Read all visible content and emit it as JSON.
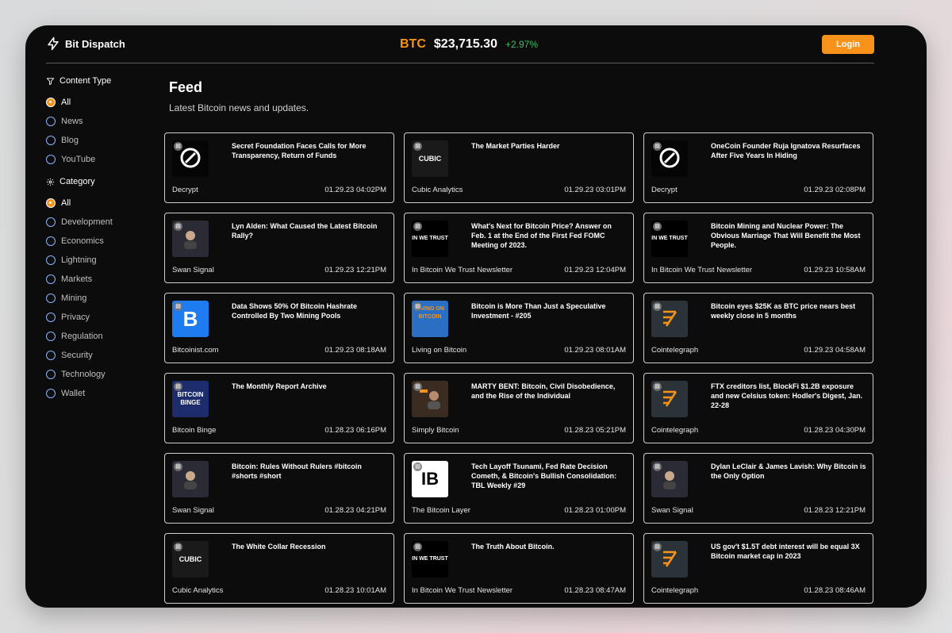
{
  "brand": {
    "name": "Bit Dispatch"
  },
  "ticker": {
    "symbol": "BTC",
    "price": "$23,715.30",
    "change": "+2.97%"
  },
  "header": {
    "login_label": "Login"
  },
  "sidebar": {
    "content_type": {
      "title": "Content Type",
      "options": [
        {
          "label": "All",
          "checked": true
        },
        {
          "label": "News",
          "checked": false
        },
        {
          "label": "Blog",
          "checked": false
        },
        {
          "label": "YouTube",
          "checked": false
        }
      ]
    },
    "category": {
      "title": "Category",
      "options": [
        {
          "label": "All",
          "checked": true
        },
        {
          "label": "Development",
          "checked": false
        },
        {
          "label": "Economics",
          "checked": false
        },
        {
          "label": "Lightning",
          "checked": false
        },
        {
          "label": "Markets",
          "checked": false
        },
        {
          "label": "Mining",
          "checked": false
        },
        {
          "label": "Privacy",
          "checked": false
        },
        {
          "label": "Regulation",
          "checked": false
        },
        {
          "label": "Security",
          "checked": false
        },
        {
          "label": "Technology",
          "checked": false
        },
        {
          "label": "Wallet",
          "checked": false
        }
      ]
    }
  },
  "main": {
    "title": "Feed",
    "subtitle": "Latest Bitcoin news and updates.",
    "cards": [
      {
        "title": "Secret Foundation Faces Calls for More Transparency, Return of Funds",
        "source": "Decrypt",
        "time": "01.29.23 04:02PM",
        "thumb": "decrypt"
      },
      {
        "title": "The Market Parties Harder",
        "source": "Cubic Analytics",
        "time": "01.29.23 03:01PM",
        "thumb": "cubic"
      },
      {
        "title": "OneCoin Founder Ruja Ignatova Resurfaces After Five Years In Hiding",
        "source": "Decrypt",
        "time": "01.29.23 02:08PM",
        "thumb": "decrypt"
      },
      {
        "title": "Lyn Alden: What Caused the Latest Bitcoin Rally?",
        "source": "Swan Signal",
        "time": "01.29.23 12:21PM",
        "thumb": "swan"
      },
      {
        "title": "What's Next for Bitcoin Price? Answer on Feb. 1 at the End of the First Fed FOMC Meeting of 2023.",
        "source": "In Bitcoin We Trust Newsletter",
        "time": "01.29.23 12:04PM",
        "thumb": "ibwt"
      },
      {
        "title": "Bitcoin Mining and Nuclear Power: The Obvious Marriage That Will Benefit the Most People.",
        "source": "In Bitcoin We Trust Newsletter",
        "time": "01.29.23 10:58AM",
        "thumb": "ibwt"
      },
      {
        "title": "Data Shows 50% Of Bitcoin Hashrate Controlled By Two Mining Pools",
        "source": "Bitcoinist.com",
        "time": "01.29.23 08:18AM",
        "thumb": "bitcoinist"
      },
      {
        "title": "Bitcoin is More Than Just a Speculative Investment - #205",
        "source": "Living on Bitcoin",
        "time": "01.29.23 08:01AM",
        "thumb": "lob"
      },
      {
        "title": "Bitcoin eyes $25K as BTC price nears best weekly close in 5 months",
        "source": "Cointelegraph",
        "time": "01.29.23 04:58AM",
        "thumb": "ct"
      },
      {
        "title": "The Monthly Report Archive",
        "source": "Bitcoin Binge",
        "time": "01.28.23 06:16PM",
        "thumb": "binge"
      },
      {
        "title": "MARTY BENT: Bitcoin, Civil Disobedience, and the Rise of the Individual",
        "source": "Simply Bitcoin",
        "time": "01.28.23 05:21PM",
        "thumb": "simply"
      },
      {
        "title": "FTX creditors list, BlockFi $1.2B exposure and new Celsius token: Hodler's Digest, Jan. 22-28",
        "source": "Cointelegraph",
        "time": "01.28.23 04:30PM",
        "thumb": "ct"
      },
      {
        "title": "Bitcoin: Rules Without Rulers #bitcoin #shorts #short",
        "source": "Swan Signal",
        "time": "01.28.23 04:21PM",
        "thumb": "swan"
      },
      {
        "title": "Tech Layoff Tsunami, Fed Rate Decision Cometh, & Bitcoin's Bullish Consolidation: TBL Weekly #29",
        "source": "The Bitcoin Layer",
        "time": "01.28.23 01:00PM",
        "thumb": "layer"
      },
      {
        "title": "Dylan LeClair & James Lavish: Why Bitcoin is the Only Option",
        "source": "Swan Signal",
        "time": "01.28.23 12:21PM",
        "thumb": "swan"
      },
      {
        "title": "The White Collar Recession",
        "source": "Cubic Analytics",
        "time": "01.28.23 10:01AM",
        "thumb": "cubic"
      },
      {
        "title": "The Truth About Bitcoin.",
        "source": "In Bitcoin We Trust Newsletter",
        "time": "01.28.23 08:47AM",
        "thumb": "ibwt"
      },
      {
        "title": "US gov't $1.5T debt interest will be equal 3X Bitcoin market cap in 2023",
        "source": "Cointelegraph",
        "time": "01.28.23 08:46AM",
        "thumb": "ct"
      }
    ]
  },
  "thumb_text": {
    "cubic": "CUBIC",
    "ibwt": "IN WE TRUST",
    "bitcoinist": "B",
    "lob": "LIVING ON BITCOIN",
    "binge": "BITCOIN BINGE",
    "layer": "IB"
  },
  "colors": {
    "accent": "#f7931a",
    "positive": "#3fbf5f",
    "background": "#0c0c0c"
  }
}
